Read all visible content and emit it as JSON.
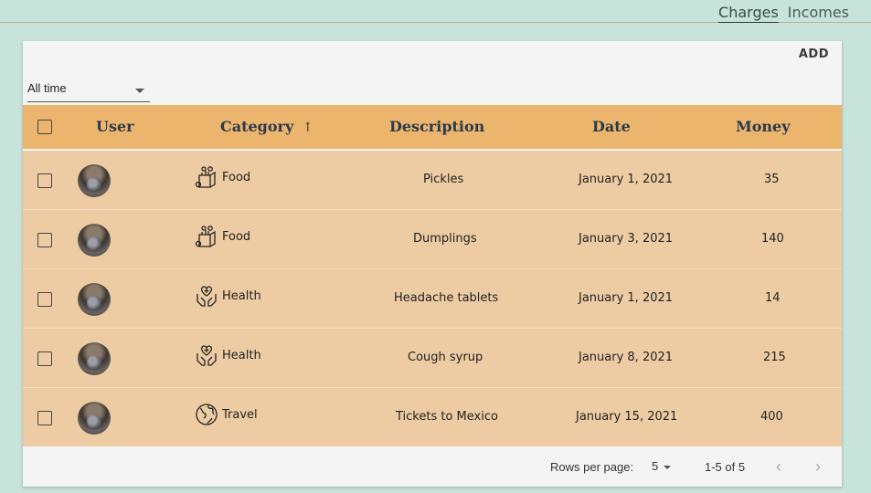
{
  "nav": {
    "charges": "Charges",
    "incomes": "Incomes"
  },
  "toolbar": {
    "add_label": "ADD"
  },
  "filter": {
    "selected": "All time"
  },
  "table": {
    "columns": [
      "User",
      "Category",
      "Description",
      "Date",
      "Money"
    ],
    "sort_indicator": "↑",
    "rows": [
      {
        "category": "Food",
        "category_icon": "grocery-bag-icon",
        "description": "Pickles",
        "date": "January 1, 2021",
        "money": "35"
      },
      {
        "category": "Food",
        "category_icon": "grocery-bag-icon",
        "description": "Dumplings",
        "date": "January 3, 2021",
        "money": "140"
      },
      {
        "category": "Health",
        "category_icon": "health-hands-icon",
        "description": "Headache tablets",
        "date": "January 1, 2021",
        "money": "14"
      },
      {
        "category": "Health",
        "category_icon": "health-hands-icon",
        "description": "Cough syrup",
        "date": "January 8, 2021",
        "money": "215"
      },
      {
        "category": "Travel",
        "category_icon": "globe-icon",
        "description": "Tickets to Mexico",
        "date": "January 15, 2021",
        "money": "400"
      }
    ]
  },
  "pagination": {
    "rows_label": "Rows per page:",
    "rows_value": "5",
    "range": "1-5 of 5",
    "prev": "‹",
    "next": "›"
  },
  "colors": {
    "background": "#c8e3d9",
    "header": "#ecb56e",
    "row": "#eecca3",
    "card": "#f4f4f4"
  }
}
